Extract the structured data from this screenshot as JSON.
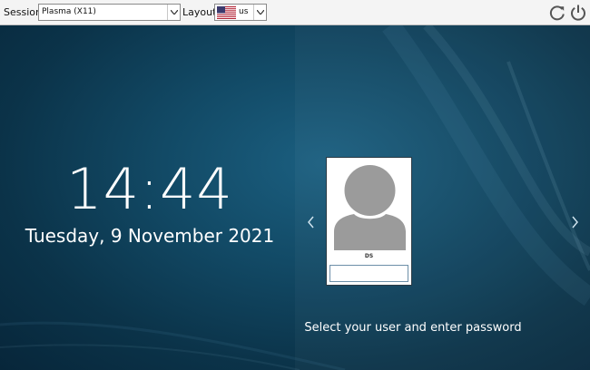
{
  "topbar": {
    "session_label": "Session",
    "session_value": "Plasma (X11)",
    "layout_label": "Layout",
    "layout_value": "us",
    "layout_flag": "us-flag-icon",
    "reboot_icon": "reboot-icon",
    "shutdown_icon": "power-icon"
  },
  "clock": {
    "time": "14:44",
    "date": "Tuesday, 9 November 2021"
  },
  "user_selector": {
    "prev_icon": "chevron-left-icon",
    "next_icon": "chevron-right-icon",
    "user_name": "DS",
    "avatar_icon": "user-avatar-icon",
    "password_value": ""
  },
  "prompt": "Select your user and enter password",
  "colors": {
    "background": "#124a66",
    "toolbar": "#f4f4f4",
    "text_light": "#ffffff"
  }
}
